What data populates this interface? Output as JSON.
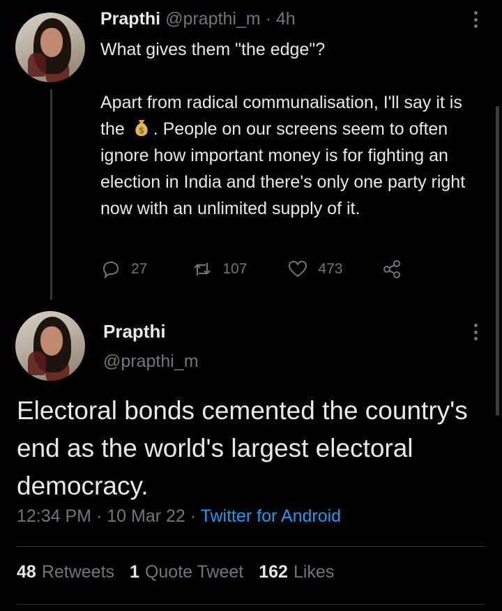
{
  "tweet1": {
    "author_name": "Prapthi",
    "handle": "@prapthi_m",
    "separator": "·",
    "time": "4h",
    "line1": "What gives them \"the edge\"?",
    "para2_before_emoji": "Apart from radical communalisation, I'll say it is the",
    "emoji": "money-bag-icon",
    "para2_after_emoji": ". People on our screens seem to often ignore how important money is for fighting an election in India and there's only one party right now with an unlimited supply of it.",
    "replies": "27",
    "retweets": "107",
    "likes": "473"
  },
  "tweet2": {
    "author_name": "Prapthi",
    "handle": "@prapthi_m",
    "text": "Electoral bonds cemented the country's end as the world's largest electoral democracy.",
    "time": "12:34 PM",
    "sep1": "·",
    "date": "10 Mar 22",
    "sep2": "·",
    "source": "Twitter for Android",
    "stats": {
      "retweets_count": "48",
      "retweets_label": "Retweets",
      "quotes_count": "1",
      "quotes_label": "Quote Tweet",
      "likes_count": "162",
      "likes_label": "Likes"
    }
  },
  "colors": {
    "background": "#000000",
    "text": "#e7e9ea",
    "muted": "#71767b",
    "link": "#1d9bf0",
    "divider": "#2f3336"
  }
}
